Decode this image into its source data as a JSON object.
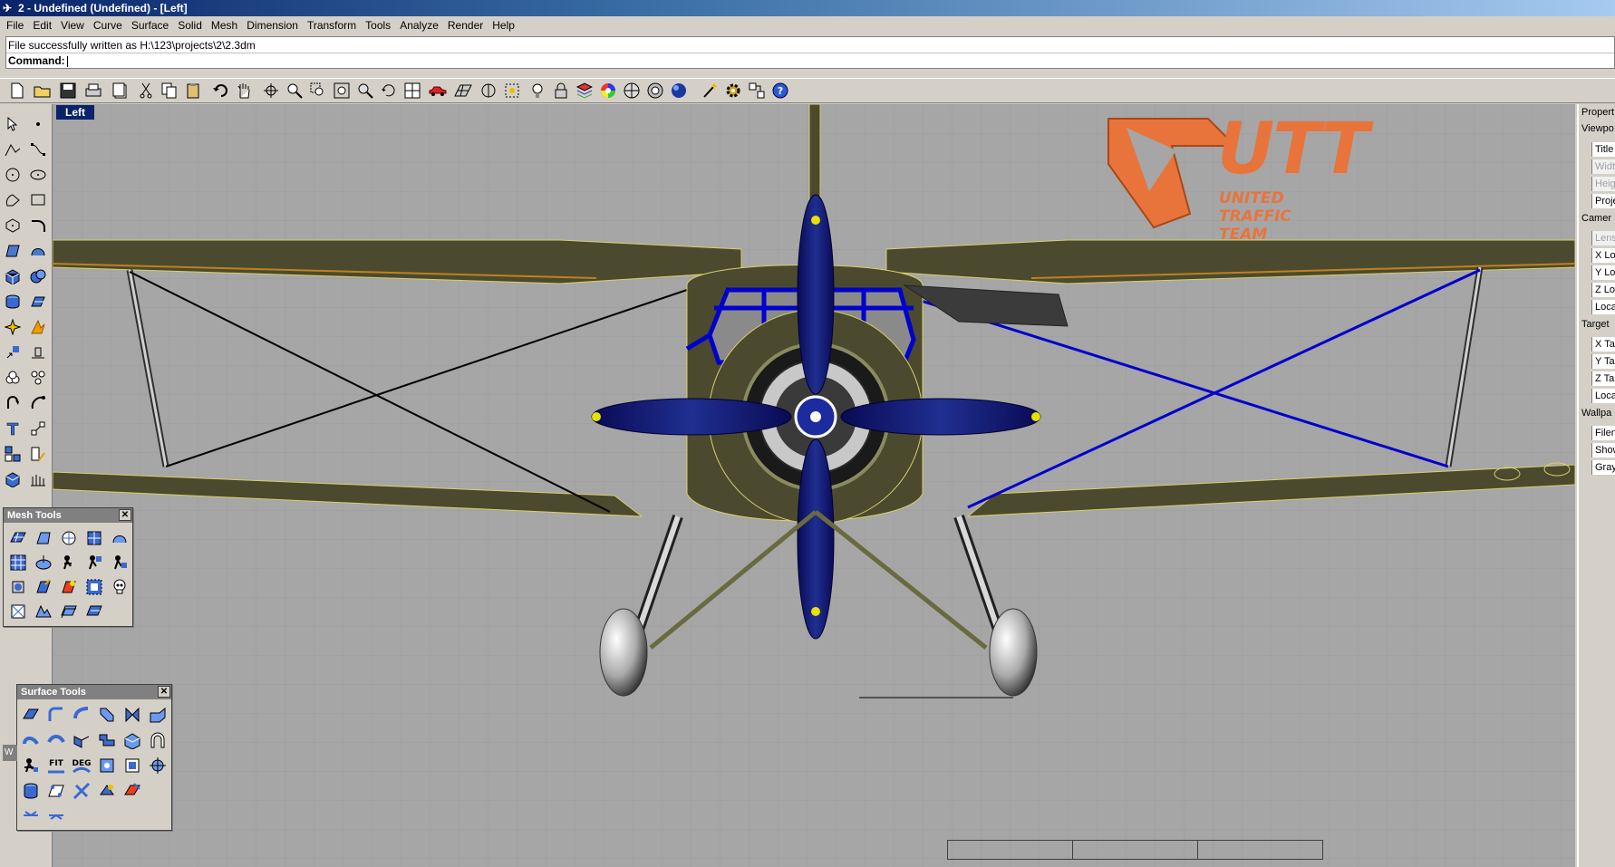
{
  "window": {
    "title": "2 - Undefined (Undefined) - [Left]",
    "app_icon": "rhino-icon"
  },
  "menu": [
    "File",
    "Edit",
    "View",
    "Curve",
    "Surface",
    "Solid",
    "Mesh",
    "Dimension",
    "Transform",
    "Tools",
    "Analyze",
    "Render",
    "Help"
  ],
  "command": {
    "history": "File successfully written as H:\\123\\projects\\2\\2.3dm",
    "prompt": "Command:"
  },
  "toolbar_icons": [
    "new-icon",
    "open-icon",
    "save-icon",
    "print-icon",
    "import-icon",
    "cut-icon",
    "copy-icon",
    "paste-icon",
    "undo-icon",
    "pan-icon",
    "rotate-view-icon",
    "zoom-icon",
    "zoom-window-icon",
    "zoom-extents-icon",
    "zoom-selected-icon",
    "undo-view-icon",
    "four-views-icon",
    "car-icon",
    "grid-icon",
    "osnap-icon",
    "select-points-icon",
    "light-icon",
    "lock-icon",
    "layer-icon",
    "color-wheel-icon",
    "shade-icon",
    "render-icon",
    "sphere-icon",
    "wand-icon",
    "gear-icon",
    "options-icon",
    "help-icon"
  ],
  "viewport": {
    "label": "Left",
    "background": "#a6a6a6",
    "accent_blue": "#0000cc",
    "plane_olive": "#4b4a2e"
  },
  "properties": {
    "header": "Propert",
    "sections": [
      {
        "title": "Viewpo",
        "fields": [
          {
            "label": "Title",
            "enabled": true
          },
          {
            "label": "Widt",
            "enabled": false
          },
          {
            "label": "Heig",
            "enabled": false
          },
          {
            "label": "Proje",
            "enabled": true
          }
        ]
      },
      {
        "title": "Camer",
        "fields": [
          {
            "label": "Lens",
            "enabled": false
          },
          {
            "label": "X Lo",
            "enabled": true
          },
          {
            "label": "Y Lo",
            "enabled": true
          },
          {
            "label": "Z Lo",
            "enabled": true
          },
          {
            "label": "Loca",
            "enabled": true
          }
        ]
      },
      {
        "title": "Target",
        "fields": [
          {
            "label": "X Ta",
            "enabled": true
          },
          {
            "label": "Y Ta",
            "enabled": true
          },
          {
            "label": "Z Ta",
            "enabled": true
          },
          {
            "label": "Loca",
            "enabled": true
          }
        ]
      },
      {
        "title": "Wallpa",
        "fields": [
          {
            "label": "Filen",
            "enabled": true
          },
          {
            "label": "Show",
            "enabled": true
          },
          {
            "label": "Gray",
            "enabled": true
          }
        ]
      }
    ]
  },
  "mesh_tools": {
    "title": "Mesh Tools",
    "close": "✕"
  },
  "surface_tools": {
    "title": "Surface Tools",
    "close": "✕",
    "labels": {
      "fit": "FIT",
      "deg": "DEG"
    }
  },
  "logo": {
    "brand": "UTT",
    "tagline": "UNITED TRAFFIC TEAM",
    "color": "#e8743b"
  },
  "left_panel_stub": "W"
}
